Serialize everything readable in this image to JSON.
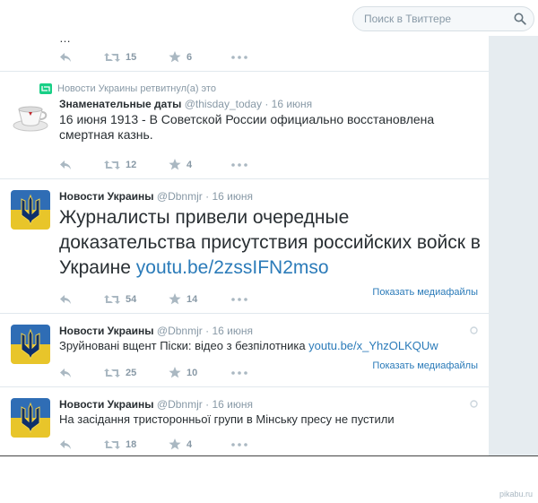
{
  "search": {
    "placeholder": "Поиск в Твиттере"
  },
  "tweets": [
    {
      "retweets": "15",
      "favorites": "6"
    },
    {
      "retweet_context": "Новости Украины ретвитнул(а) это",
      "fullname": "Знаменательные даты",
      "username": "@thisday_today",
      "time": "16 июня",
      "text": "16 июня 1913 -  В Советской России официально восстановлена смертная казнь.",
      "retweets": "12",
      "favorites": "4"
    },
    {
      "fullname": "Новости Украины",
      "username": "@Dbnmjr",
      "time": "16 июня",
      "text": "Журналисты привели очередные доказательства присутствия российских войск в Украине ",
      "link": "youtu.be/2zssIFN2mso",
      "retweets": "54",
      "favorites": "14",
      "media": "Показать медиафайлы"
    },
    {
      "fullname": "Новости Украины",
      "username": "@Dbnmjr",
      "time": "16 июня",
      "text": "Зруйновані вщент Піски: відео з безпілотника ",
      "link": "youtu.be/x_YhzOLKQUw",
      "retweets": "25",
      "favorites": "10",
      "media": "Показать медиафайлы"
    },
    {
      "fullname": "Новости Украины",
      "username": "@Dbnmjr",
      "time": "16 июня",
      "text": "На засідання тристоронньої групи в Мінську пресу не пустили",
      "retweets": "18",
      "favorites": "4"
    }
  ],
  "watermark": "pikabu.ru",
  "colors": {
    "link": "#2b7bb9",
    "muted": "#8899a6",
    "retweet_green": "#19cf86"
  }
}
